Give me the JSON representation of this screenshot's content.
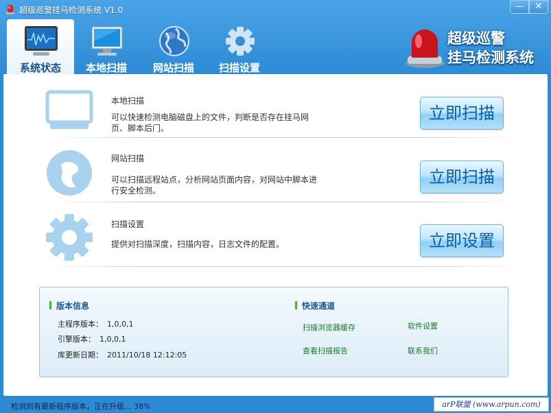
{
  "window": {
    "title": "超级巡警挂马检测系统 V1.0",
    "min_label": "—",
    "close_label": "✕"
  },
  "tabs": [
    {
      "label": "系统状态",
      "icon": "monitor-chart-icon",
      "active": true
    },
    {
      "label": "本地扫描",
      "icon": "monitor-icon",
      "active": false
    },
    {
      "label": "网站扫描",
      "icon": "globe-icon",
      "active": false
    },
    {
      "label": "扫描设置",
      "icon": "gear-icon",
      "active": false
    }
  ],
  "brand": {
    "line1": "超级巡警",
    "line2": "挂马检测系统",
    "icon": "siren-icon"
  },
  "features": [
    {
      "title": "本地扫描",
      "desc": "可以快速检测电脑磁盘上的文件，判断是否存在挂马网页、脚本后门。",
      "button": "立即扫描",
      "icon": "monitor-icon"
    },
    {
      "title": "网站扫描",
      "desc": "可以扫描远程站点，分析网站页面内容，对网站中脚本进行安全检测。",
      "button": "立即扫描",
      "icon": "ie-globe-icon"
    },
    {
      "title": "扫描设置",
      "desc": "提供对扫描深度，扫描内容，日志文件的配置。",
      "button": "立即设置",
      "icon": "gear-icon"
    }
  ],
  "version_info": {
    "title": "版本信息",
    "main_label": "主程序版本：",
    "main_value": "1,0,0,1",
    "engine_label": "引擎版本：",
    "engine_value": "1,0,0,1",
    "db_label": "库更新日期：",
    "db_value": "2011/10/18 12:12:05"
  },
  "quick": {
    "title": "快速通道",
    "links": [
      "扫描浏览器缓存",
      "软件设置",
      "查看扫描报告",
      "联系我们"
    ]
  },
  "status": {
    "text": "检测到有最新程序版本，正在升级... 38%",
    "progress_percent": 38,
    "watermark": "arP联盟 (www.arpun.com)"
  },
  "colors": {
    "frame": "#2d8ad4",
    "button_text": "#0b5ea5",
    "link": "#1a7a2a",
    "section_mark": "#4caa3d"
  }
}
